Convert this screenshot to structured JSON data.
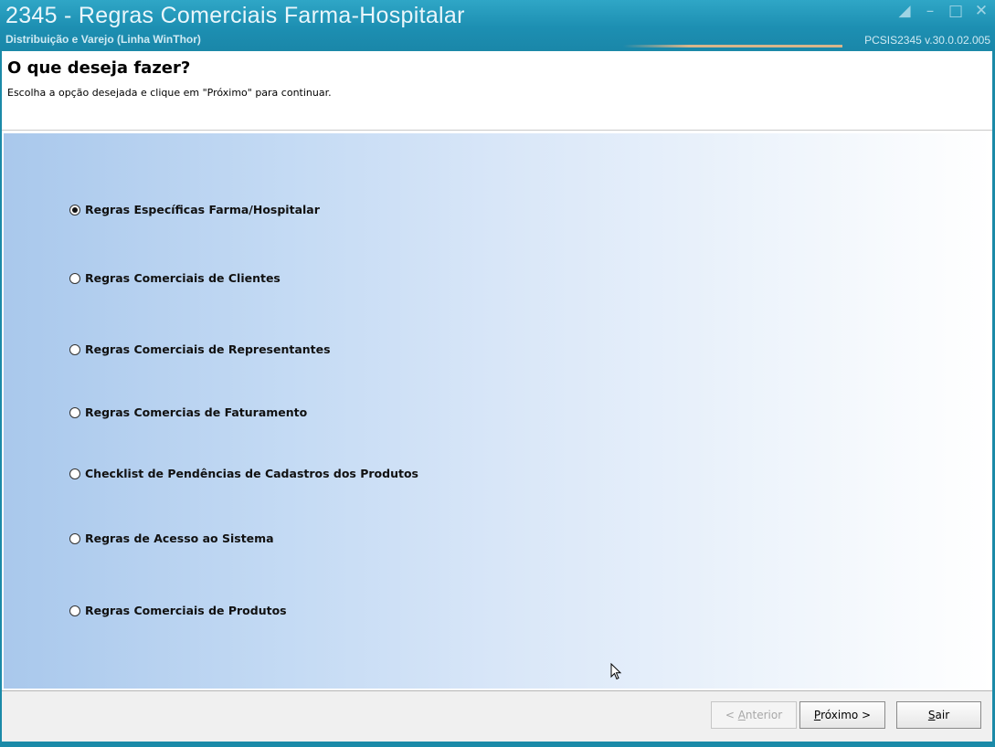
{
  "window": {
    "title": "2345 - Regras Comerciais Farma-Hospitalar",
    "subtitle": "Distribuição e Varejo (Linha WinThor)",
    "version": "PCSIS2345  v.30.0.02.005",
    "buttons": [
      "restore-icon",
      "minimize-icon",
      "maximize-icon",
      "close-icon"
    ]
  },
  "header": {
    "heading": "O que deseja fazer?",
    "instruction": "Escolha a opção desejada e clique em \"Próximo\" para continuar."
  },
  "options": [
    {
      "label": "Regras Específicas Farma/Hospitalar",
      "selected": true
    },
    {
      "label": "Regras Comerciais de Clientes",
      "selected": false
    },
    {
      "label": "Regras Comerciais de Representantes",
      "selected": false
    },
    {
      "label": "Regras Comercias de Faturamento",
      "selected": false
    },
    {
      "label": "Checklist de Pendências de Cadastros dos Produtos",
      "selected": false
    },
    {
      "label": "Regras de Acesso ao Sistema",
      "selected": false
    },
    {
      "label": "Regras Comerciais de Produtos",
      "selected": false
    }
  ],
  "footer": {
    "previous": {
      "prefix": "< ",
      "mnemonic": "A",
      "rest": "nterior",
      "enabled": false
    },
    "next": {
      "mnemonic": "P",
      "rest": "róximo >",
      "enabled": true
    },
    "exit": {
      "mnemonic": "S",
      "rest": "air",
      "enabled": true
    }
  },
  "colors": {
    "titlebar": "#1d8fb2",
    "panel_gradient_start": "#a9c8ec",
    "panel_gradient_end": "#ffffff"
  }
}
